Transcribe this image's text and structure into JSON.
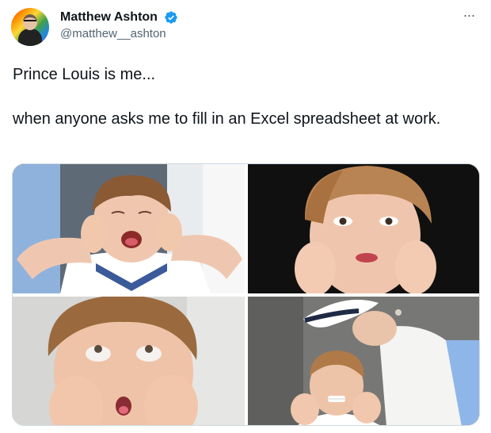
{
  "tweet": {
    "author": {
      "display_name": "Matthew Ashton",
      "handle": "@matthew__ashton",
      "verified": true,
      "verified_color": "#1d9bf0"
    },
    "more_icon": "ellipsis-icon",
    "text_lines": [
      "Prince Louis is me...",
      "when anyone asks me to fill in an Excel spreadsheet at work."
    ],
    "media": {
      "photo_count": 4
    }
  }
}
